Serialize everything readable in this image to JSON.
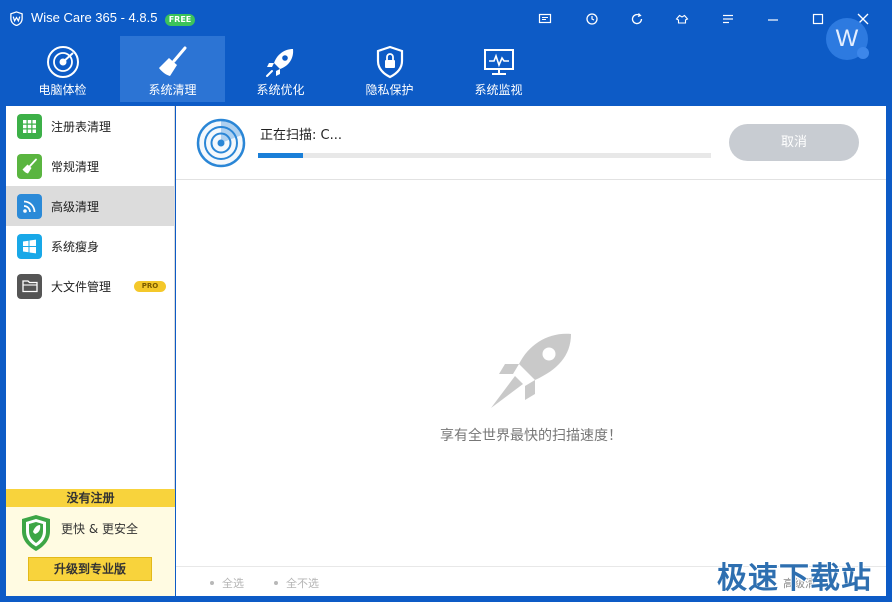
{
  "window": {
    "title": "Wise Care 365 - 4.8.5",
    "badge": "FREE",
    "controls": [
      "feedback-icon",
      "restore-icon",
      "refresh-icon",
      "skin-icon",
      "menu-icon",
      "minimize-icon",
      "maximize-icon",
      "close-icon"
    ]
  },
  "nav": {
    "tabs": [
      {
        "label": "电脑体检",
        "icon": "radar-icon",
        "active": false
      },
      {
        "label": "系统清理",
        "icon": "broom-icon",
        "active": true
      },
      {
        "label": "系统优化",
        "icon": "rocket-icon",
        "active": false
      },
      {
        "label": "隐私保护",
        "icon": "shield-lock-icon",
        "active": false
      },
      {
        "label": "系统监视",
        "icon": "monitor-icon",
        "active": false
      }
    ],
    "avatar_letter": "W"
  },
  "sidebar": {
    "items": [
      {
        "label": "注册表清理",
        "icon": "grid-icon",
        "color": "#3cb048"
      },
      {
        "label": "常规清理",
        "icon": "broom-icon",
        "color": "#5ab540"
      },
      {
        "label": "高级清理",
        "icon": "wifi-icon",
        "color": "#2b8ad8",
        "active": true
      },
      {
        "label": "系统瘦身",
        "icon": "windows-icon",
        "color": "#18a8e8"
      },
      {
        "label": "大文件管理",
        "icon": "folder-icon",
        "color": "#555555",
        "badge": "PRO"
      }
    ],
    "registration": {
      "heading": "没有注册",
      "tagline": "更快 & 更安全",
      "upgrade_label": "升级到专业版"
    }
  },
  "scan": {
    "status_text": "正在扫描: C...",
    "progress": 0.1,
    "cancel_label": "取消"
  },
  "main": {
    "slogan": "享有全世界最快的扫描速度！"
  },
  "footer": {
    "select_all": "全选",
    "select_none": "全不选"
  },
  "watermark": {
    "text": "极速下载站",
    "sub": "高级清理"
  },
  "colors": {
    "accent": "#0d5bc6",
    "active_tab": "#2c74d4",
    "progress": "#1a7fd8",
    "registration": "#f8d33c"
  }
}
